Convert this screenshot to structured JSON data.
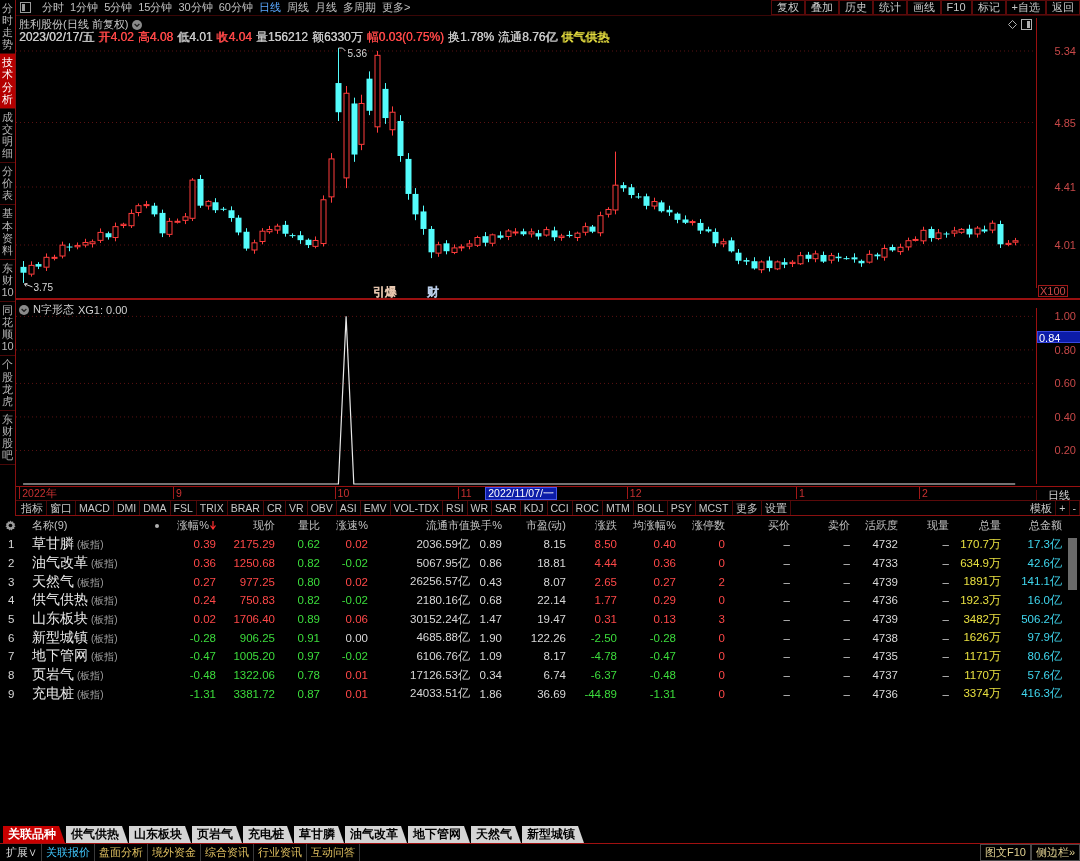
{
  "sidebar": {
    "tabs": [
      {
        "label": "分时走势",
        "selected": false
      },
      {
        "label": "技术分析",
        "selected": true
      },
      {
        "label": "成交明细",
        "selected": false
      },
      {
        "label": "分价表",
        "selected": false
      },
      {
        "label": "基本资料",
        "selected": false
      },
      {
        "label": "东财10",
        "selected": false
      },
      {
        "label": "同花顺10",
        "selected": false
      },
      {
        "label": "个股龙虎",
        "selected": false
      },
      {
        "label": "东财股吧",
        "selected": false
      }
    ]
  },
  "toolbar": {
    "periods": [
      {
        "label": "分时",
        "selected": false
      },
      {
        "label": "1分钟",
        "selected": false
      },
      {
        "label": "5分钟",
        "selected": false
      },
      {
        "label": "15分钟",
        "selected": false
      },
      {
        "label": "30分钟",
        "selected": false
      },
      {
        "label": "60分钟",
        "selected": false
      },
      {
        "label": "日线",
        "selected": true
      },
      {
        "label": "周线",
        "selected": false
      },
      {
        "label": "月线",
        "selected": false
      },
      {
        "label": "多周期",
        "selected": false
      },
      {
        "label": "更多>",
        "selected": false
      }
    ],
    "actions": [
      "复权",
      "叠加",
      "历史",
      "统计",
      "画线",
      "F10",
      "标记",
      "+自选",
      "返回"
    ]
  },
  "price_chart": {
    "title": "胜利股份(日线 前复权)",
    "quote": [
      {
        "text": "2023/02/17/五",
        "color": "#c8c8c8"
      },
      {
        "text": "开4.02",
        "color": "#ff4848"
      },
      {
        "text": "高4.08",
        "color": "#ff4848"
      },
      {
        "text": "低4.01",
        "color": "#c8c8c8"
      },
      {
        "text": "收4.04",
        "color": "#ff4848"
      },
      {
        "text": "量156212",
        "color": "#c8c8c8"
      },
      {
        "text": "额6330万",
        "color": "#c8c8c8"
      },
      {
        "text": "幅0.03(0.75%)",
        "color": "#ff4848"
      },
      {
        "text": "换1.78%",
        "color": "#c8c8c8"
      },
      {
        "text": "流通8.76亿",
        "color": "#c8c8c8"
      },
      {
        "text": "供气供热",
        "color": "#e8e040"
      }
    ],
    "axis_ticks": [
      "5.34",
      "4.85",
      "4.41",
      "4.01"
    ],
    "scale_label": "X100",
    "high_label": "5.36",
    "low_label": "3.75",
    "events": [
      {
        "label": "引爆",
        "color": "#e8c8b0"
      },
      {
        "label": "财",
        "color": "#c0d4f0"
      }
    ]
  },
  "indicator": {
    "title": "N字形态",
    "readout": "XG1: 0.00",
    "cursor_value": "0.84",
    "chart_data": {
      "type": "line",
      "ylim": [
        0,
        1.05
      ],
      "yticks": [
        {
          "value": 0.2,
          "label": "0.20"
        },
        {
          "value": 0.4,
          "label": "0.40"
        },
        {
          "value": 0.6,
          "label": "0.60"
        },
        {
          "value": 0.8,
          "label": "0.80"
        },
        {
          "value": 1,
          "label": "1.00"
        }
      ],
      "grid": true,
      "values": [
        0,
        0,
        0,
        0,
        0,
        0,
        0,
        0,
        0,
        0,
        0,
        0,
        0,
        0,
        0,
        0,
        0,
        0,
        0,
        0,
        0,
        0,
        0,
        0,
        0,
        0,
        0,
        0,
        0,
        0,
        0,
        0,
        0,
        0,
        0,
        0,
        0,
        0,
        0,
        0,
        0,
        0,
        1,
        0,
        0,
        0,
        0,
        0,
        0,
        0,
        0,
        0,
        0,
        0,
        0,
        0,
        0,
        0,
        0,
        0,
        0,
        0,
        0,
        0,
        0,
        0,
        0,
        0,
        0,
        0,
        0,
        0,
        0,
        0,
        0,
        0,
        0,
        0,
        0,
        0,
        0,
        0,
        0,
        0,
        0,
        0,
        0,
        0,
        0,
        0,
        0,
        0,
        0,
        0,
        0,
        0,
        0,
        0,
        0,
        0,
        0,
        0,
        0,
        0,
        0,
        0,
        0,
        0,
        0,
        0,
        0,
        0,
        0,
        0,
        0,
        0,
        0,
        0,
        0,
        0,
        0,
        0,
        0,
        0,
        0,
        0,
        0,
        0,
        0,
        0
      ]
    }
  },
  "time_axis": {
    "labels": [
      "2022年",
      "9",
      "10",
      "11",
      "12",
      "1",
      "2"
    ],
    "cursor_date": "2022/11/07/一",
    "period_label": "日线"
  },
  "indicator_tabs": {
    "modes": [
      "指标",
      "窗口"
    ],
    "items": [
      "MACD",
      "DMI",
      "DMA",
      "FSL",
      "TRIX",
      "BRAR",
      "CR",
      "VR",
      "OBV",
      "ASI",
      "EMV",
      "VOL-TDX",
      "RSI",
      "WR",
      "SAR",
      "KDJ",
      "CCI",
      "ROC",
      "MTM",
      "BOLL",
      "PSY",
      "MCST",
      "更多",
      "设置"
    ],
    "actions": [
      "模板",
      "+",
      "-"
    ]
  },
  "table": {
    "name_header": "名称(9)",
    "columns": [
      {
        "label": "涨幅%",
        "kind": "trend",
        "sorted": true
      },
      {
        "label": "现价",
        "kind": "trend",
        "sorted": false
      },
      {
        "label": "量比",
        "kind": "ratio",
        "sorted": false
      },
      {
        "label": "涨速%",
        "kind": "speed",
        "sorted": false
      },
      {
        "label": "流通市值",
        "kind": "plain",
        "sorted": false
      },
      {
        "label": "换手%",
        "kind": "plain",
        "sorted": false
      },
      {
        "label": "市盈(动)",
        "kind": "plain",
        "sorted": false
      },
      {
        "label": "涨跌",
        "kind": "trend",
        "sorted": false
      },
      {
        "label": "均涨幅%",
        "kind": "trend",
        "sorted": false
      },
      {
        "label": "涨停数",
        "kind": "limit",
        "sorted": false
      },
      {
        "label": "买价",
        "kind": "plain",
        "sorted": false
      },
      {
        "label": "卖价",
        "kind": "plain",
        "sorted": false
      },
      {
        "label": "活跃度",
        "kind": "plain",
        "sorted": false
      },
      {
        "label": "现量",
        "kind": "plain",
        "sorted": false
      },
      {
        "label": "总量",
        "kind": "volume",
        "sorted": false
      },
      {
        "label": "总金额",
        "kind": "amount",
        "sorted": false
      }
    ],
    "rows": [
      {
        "index": "1",
        "name": "草甘膦",
        "tag": "(板指)",
        "rising": true,
        "speed_rising": true,
        "speed_falling": false,
        "cells": [
          "0.39",
          "2175.29",
          "0.62",
          "0.02",
          "2036.59亿",
          "0.89",
          "8.15",
          "8.50",
          "0.40",
          "0",
          "–",
          "–",
          "4732",
          "–",
          "170.7万",
          "17.3亿"
        ]
      },
      {
        "index": "2",
        "name": "油气改革",
        "tag": "(板指)",
        "rising": true,
        "speed_rising": false,
        "speed_falling": true,
        "cells": [
          "0.36",
          "1250.68",
          "0.82",
          "-0.02",
          "5067.95亿",
          "0.86",
          "18.81",
          "4.44",
          "0.36",
          "0",
          "–",
          "–",
          "4733",
          "–",
          "634.9万",
          "42.6亿"
        ]
      },
      {
        "index": "3",
        "name": "天然气",
        "tag": "(板指)",
        "rising": true,
        "speed_rising": true,
        "speed_falling": false,
        "cells": [
          "0.27",
          "977.25",
          "0.80",
          "0.02",
          "26256.57亿",
          "0.43",
          "8.07",
          "2.65",
          "0.27",
          "2",
          "–",
          "–",
          "4739",
          "–",
          "1891万",
          "141.1亿"
        ]
      },
      {
        "index": "4",
        "name": "供气供热",
        "tag": "(板指)",
        "rising": true,
        "speed_rising": false,
        "speed_falling": true,
        "cells": [
          "0.24",
          "750.83",
          "0.82",
          "-0.02",
          "2180.16亿",
          "0.68",
          "22.14",
          "1.77",
          "0.29",
          "0",
          "–",
          "–",
          "4736",
          "–",
          "192.3万",
          "16.0亿"
        ]
      },
      {
        "index": "5",
        "name": "山东板块",
        "tag": "(板指)",
        "rising": true,
        "speed_rising": true,
        "speed_falling": false,
        "cells": [
          "0.02",
          "1706.40",
          "0.89",
          "0.06",
          "30152.24亿",
          "1.47",
          "19.47",
          "0.31",
          "0.13",
          "3",
          "–",
          "–",
          "4739",
          "–",
          "3482万",
          "506.2亿"
        ]
      },
      {
        "index": "6",
        "name": "新型城镇",
        "tag": "(板指)",
        "rising": false,
        "speed_rising": false,
        "speed_falling": false,
        "cells": [
          "-0.28",
          "906.25",
          "0.91",
          "0.00",
          "4685.88亿",
          "1.90",
          "122.26",
          "-2.50",
          "-0.28",
          "0",
          "–",
          "–",
          "4738",
          "–",
          "1626万",
          "97.9亿"
        ]
      },
      {
        "index": "7",
        "name": "地下管网",
        "tag": "(板指)",
        "rising": false,
        "speed_rising": false,
        "speed_falling": true,
        "cells": [
          "-0.47",
          "1005.20",
          "0.97",
          "-0.02",
          "6106.76亿",
          "1.09",
          "8.17",
          "-4.78",
          "-0.47",
          "0",
          "–",
          "–",
          "4735",
          "–",
          "1171万",
          "80.6亿"
        ]
      },
      {
        "index": "8",
        "name": "页岩气",
        "tag": "(板指)",
        "rising": false,
        "speed_rising": true,
        "speed_falling": false,
        "cells": [
          "-0.48",
          "1322.06",
          "0.78",
          "0.01",
          "17126.53亿",
          "0.34",
          "6.74",
          "-6.37",
          "-0.48",
          "0",
          "–",
          "–",
          "4737",
          "–",
          "1170万",
          "57.6亿"
        ]
      },
      {
        "index": "9",
        "name": "充电桩",
        "tag": "(板指)",
        "rising": false,
        "speed_rising": true,
        "speed_falling": false,
        "cells": [
          "-1.31",
          "3381.72",
          "0.87",
          "0.01",
          "24033.51亿",
          "1.86",
          "36.69",
          "-44.89",
          "-1.31",
          "0",
          "–",
          "–",
          "4736",
          "–",
          "3374万",
          "416.3亿"
        ]
      }
    ]
  },
  "bottom_tabs": [
    {
      "label": "关联品种",
      "selected": true
    },
    {
      "label": "供气供热",
      "selected": false
    },
    {
      "label": "山东板块",
      "selected": false
    },
    {
      "label": "页岩气",
      "selected": false
    },
    {
      "label": "充电桩",
      "selected": false
    },
    {
      "label": "草甘膦",
      "selected": false
    },
    {
      "label": "油气改革",
      "selected": false
    },
    {
      "label": "地下管网",
      "selected": false
    },
    {
      "label": "天然气",
      "selected": false
    },
    {
      "label": "新型城镇",
      "selected": false
    }
  ],
  "status_bar": {
    "expand": "扩展∨",
    "links": [
      {
        "label": "关联报价",
        "selected": true
      },
      {
        "label": "盘面分析",
        "selected": false
      },
      {
        "label": "境外资金",
        "selected": false
      },
      {
        "label": "综合资讯",
        "selected": false
      },
      {
        "label": "行业资讯",
        "selected": false
      },
      {
        "label": "互动问答",
        "selected": false
      }
    ],
    "right": [
      "图文F10",
      "侧边栏»"
    ]
  }
}
